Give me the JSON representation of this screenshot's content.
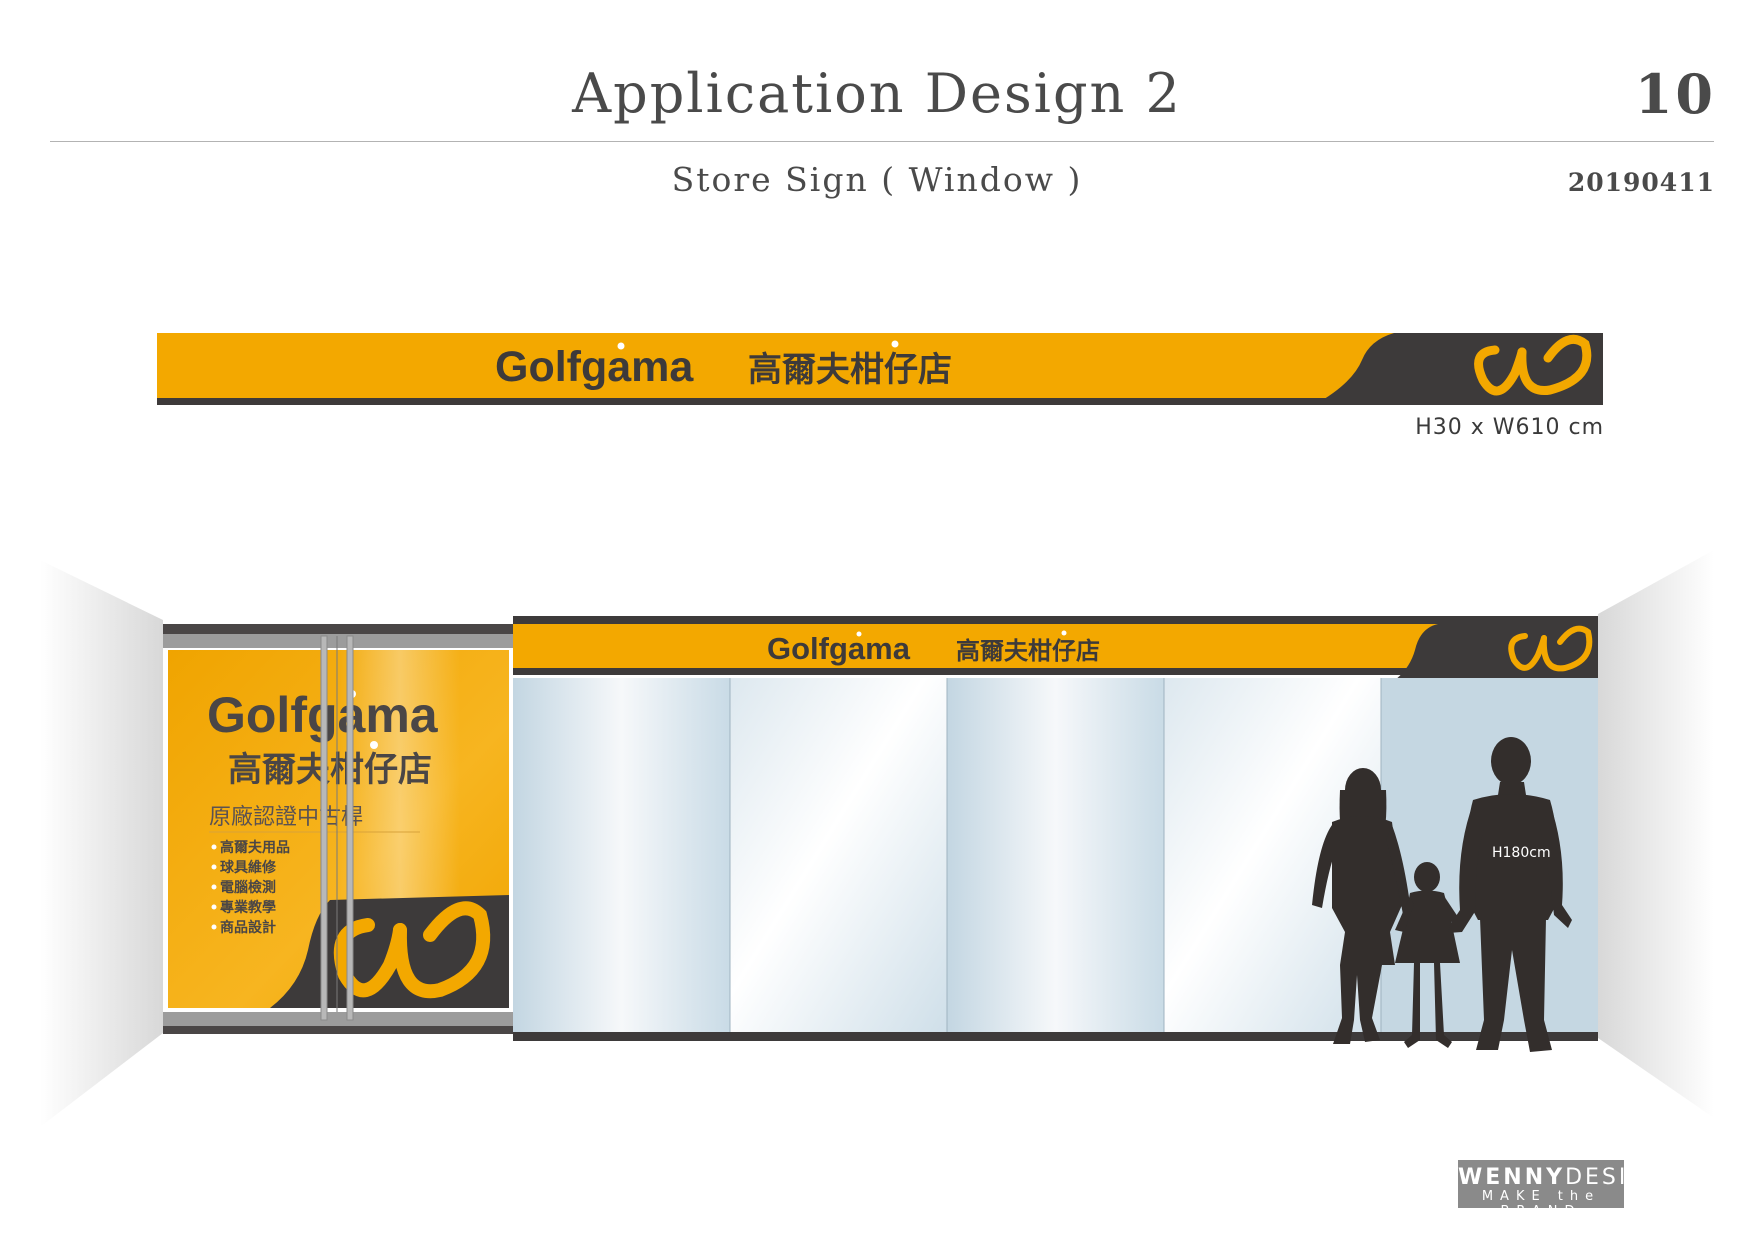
{
  "header": {
    "title": "Application Design 2",
    "page_number": "10",
    "subtitle": "Store Sign ( Window )",
    "date": "20190411"
  },
  "sign": {
    "brand": "Golfgama",
    "store_name": "高爾夫柑仔店",
    "dimension": "H30 x W610 cm",
    "colors": {
      "yellow": "#f3a800",
      "dark": "#3d3a3a"
    }
  },
  "door_poster": {
    "brand": "Golfgama",
    "store_name": "高爾夫柑仔店",
    "tagline": "原廠認證中古桿",
    "services": [
      "高爾夫用品",
      "球具維修",
      "電腦檢測",
      "專業教學",
      "商品設計"
    ]
  },
  "figures": {
    "height_label": "H180cm"
  },
  "watermark": {
    "line1_bold": "WENNY",
    "line1_rest": "DESIGN",
    "line2": "MAKE the BRAND"
  }
}
